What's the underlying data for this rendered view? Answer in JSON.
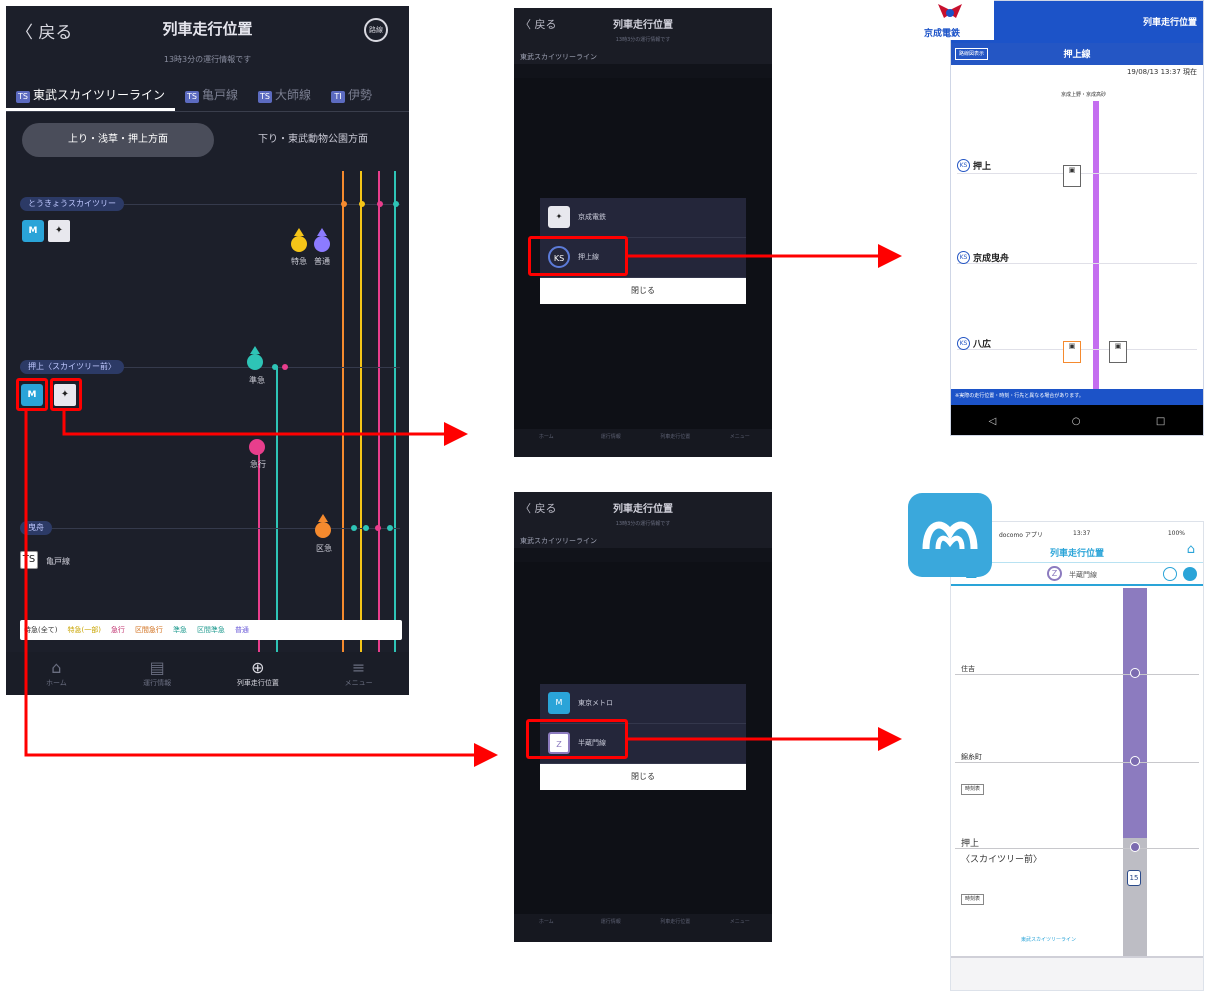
{
  "main_app": {
    "back_label": "戻る",
    "title": "列車走行位置",
    "subtitle": "13時3分の運行情報です",
    "header_btn": "路線",
    "tabs": [
      {
        "badge": "TS",
        "label": "東武スカイツリーライン"
      },
      {
        "badge": "TS",
        "label": "亀戸線"
      },
      {
        "badge": "TS",
        "label": "大師線"
      },
      {
        "badge": "TI",
        "label": "伊勢"
      }
    ],
    "direction_active": "上り・浅草・押上方面",
    "direction_other": "下り・東武動物公園方面",
    "stations": [
      {
        "name": "とうきょうスカイツリー"
      },
      {
        "name": "押上〈スカイツリー前〉"
      },
      {
        "name": "曳舟"
      }
    ],
    "connection_label": "亀戸線",
    "trains": [
      {
        "label": "特急",
        "color": "#f5c518"
      },
      {
        "label": "普通",
        "color": "#8c7bff"
      },
      {
        "label": "準急",
        "color": "#2ec4b6"
      },
      {
        "label": "急行",
        "color": "#e83e8c"
      },
      {
        "label": "区急",
        "color": "#f58a2e"
      }
    ],
    "legend": [
      "特急(全て)",
      "特急(一部)",
      "急行",
      "区間急行",
      "準急",
      "区間準急",
      "普通"
    ],
    "nav": [
      {
        "icon": "⌂",
        "label": "ホーム"
      },
      {
        "icon": "▤",
        "label": "運行情報"
      },
      {
        "icon": "⊕",
        "label": "列車走行位置"
      },
      {
        "icon": "≡",
        "label": "メニュー"
      }
    ]
  },
  "dialog_top": {
    "row1_text": "京成電鉄",
    "row2_text": "押上線",
    "close": "閉じる"
  },
  "dialog_bottom": {
    "row1_text": "東京メトロ",
    "row2_text": "半蔵門線",
    "close": "閉じる"
  },
  "keisei": {
    "brand": "京成電鉄",
    "header": "列車走行位置",
    "line_name": "押上線",
    "btn": "路線図表示",
    "timestamp": "19/08/13 13:37 現在",
    "direction": "京成上野・京成高砂",
    "stations": [
      "押上",
      "京成曳舟",
      "八広"
    ],
    "footer": "※実際の走行位置・時刻・行先と異なる場合があります。"
  },
  "metro": {
    "status_left": "docomo アプリ",
    "status_time": "13:37",
    "status_batt": "100%",
    "title": "列車走行位置",
    "line_label": "半蔵門線",
    "stations": [
      "住吉",
      "錦糸町",
      "押上"
    ],
    "sub_station": "〈スカイツリー前〉",
    "train_number": "15",
    "btn_label": "時刻表",
    "bottom_label": "東武スカイツリーライン"
  },
  "colors": {
    "highlight": "#ff0000",
    "keisei_line": "#c46ef0",
    "metro_line": "#8c7bbf"
  }
}
